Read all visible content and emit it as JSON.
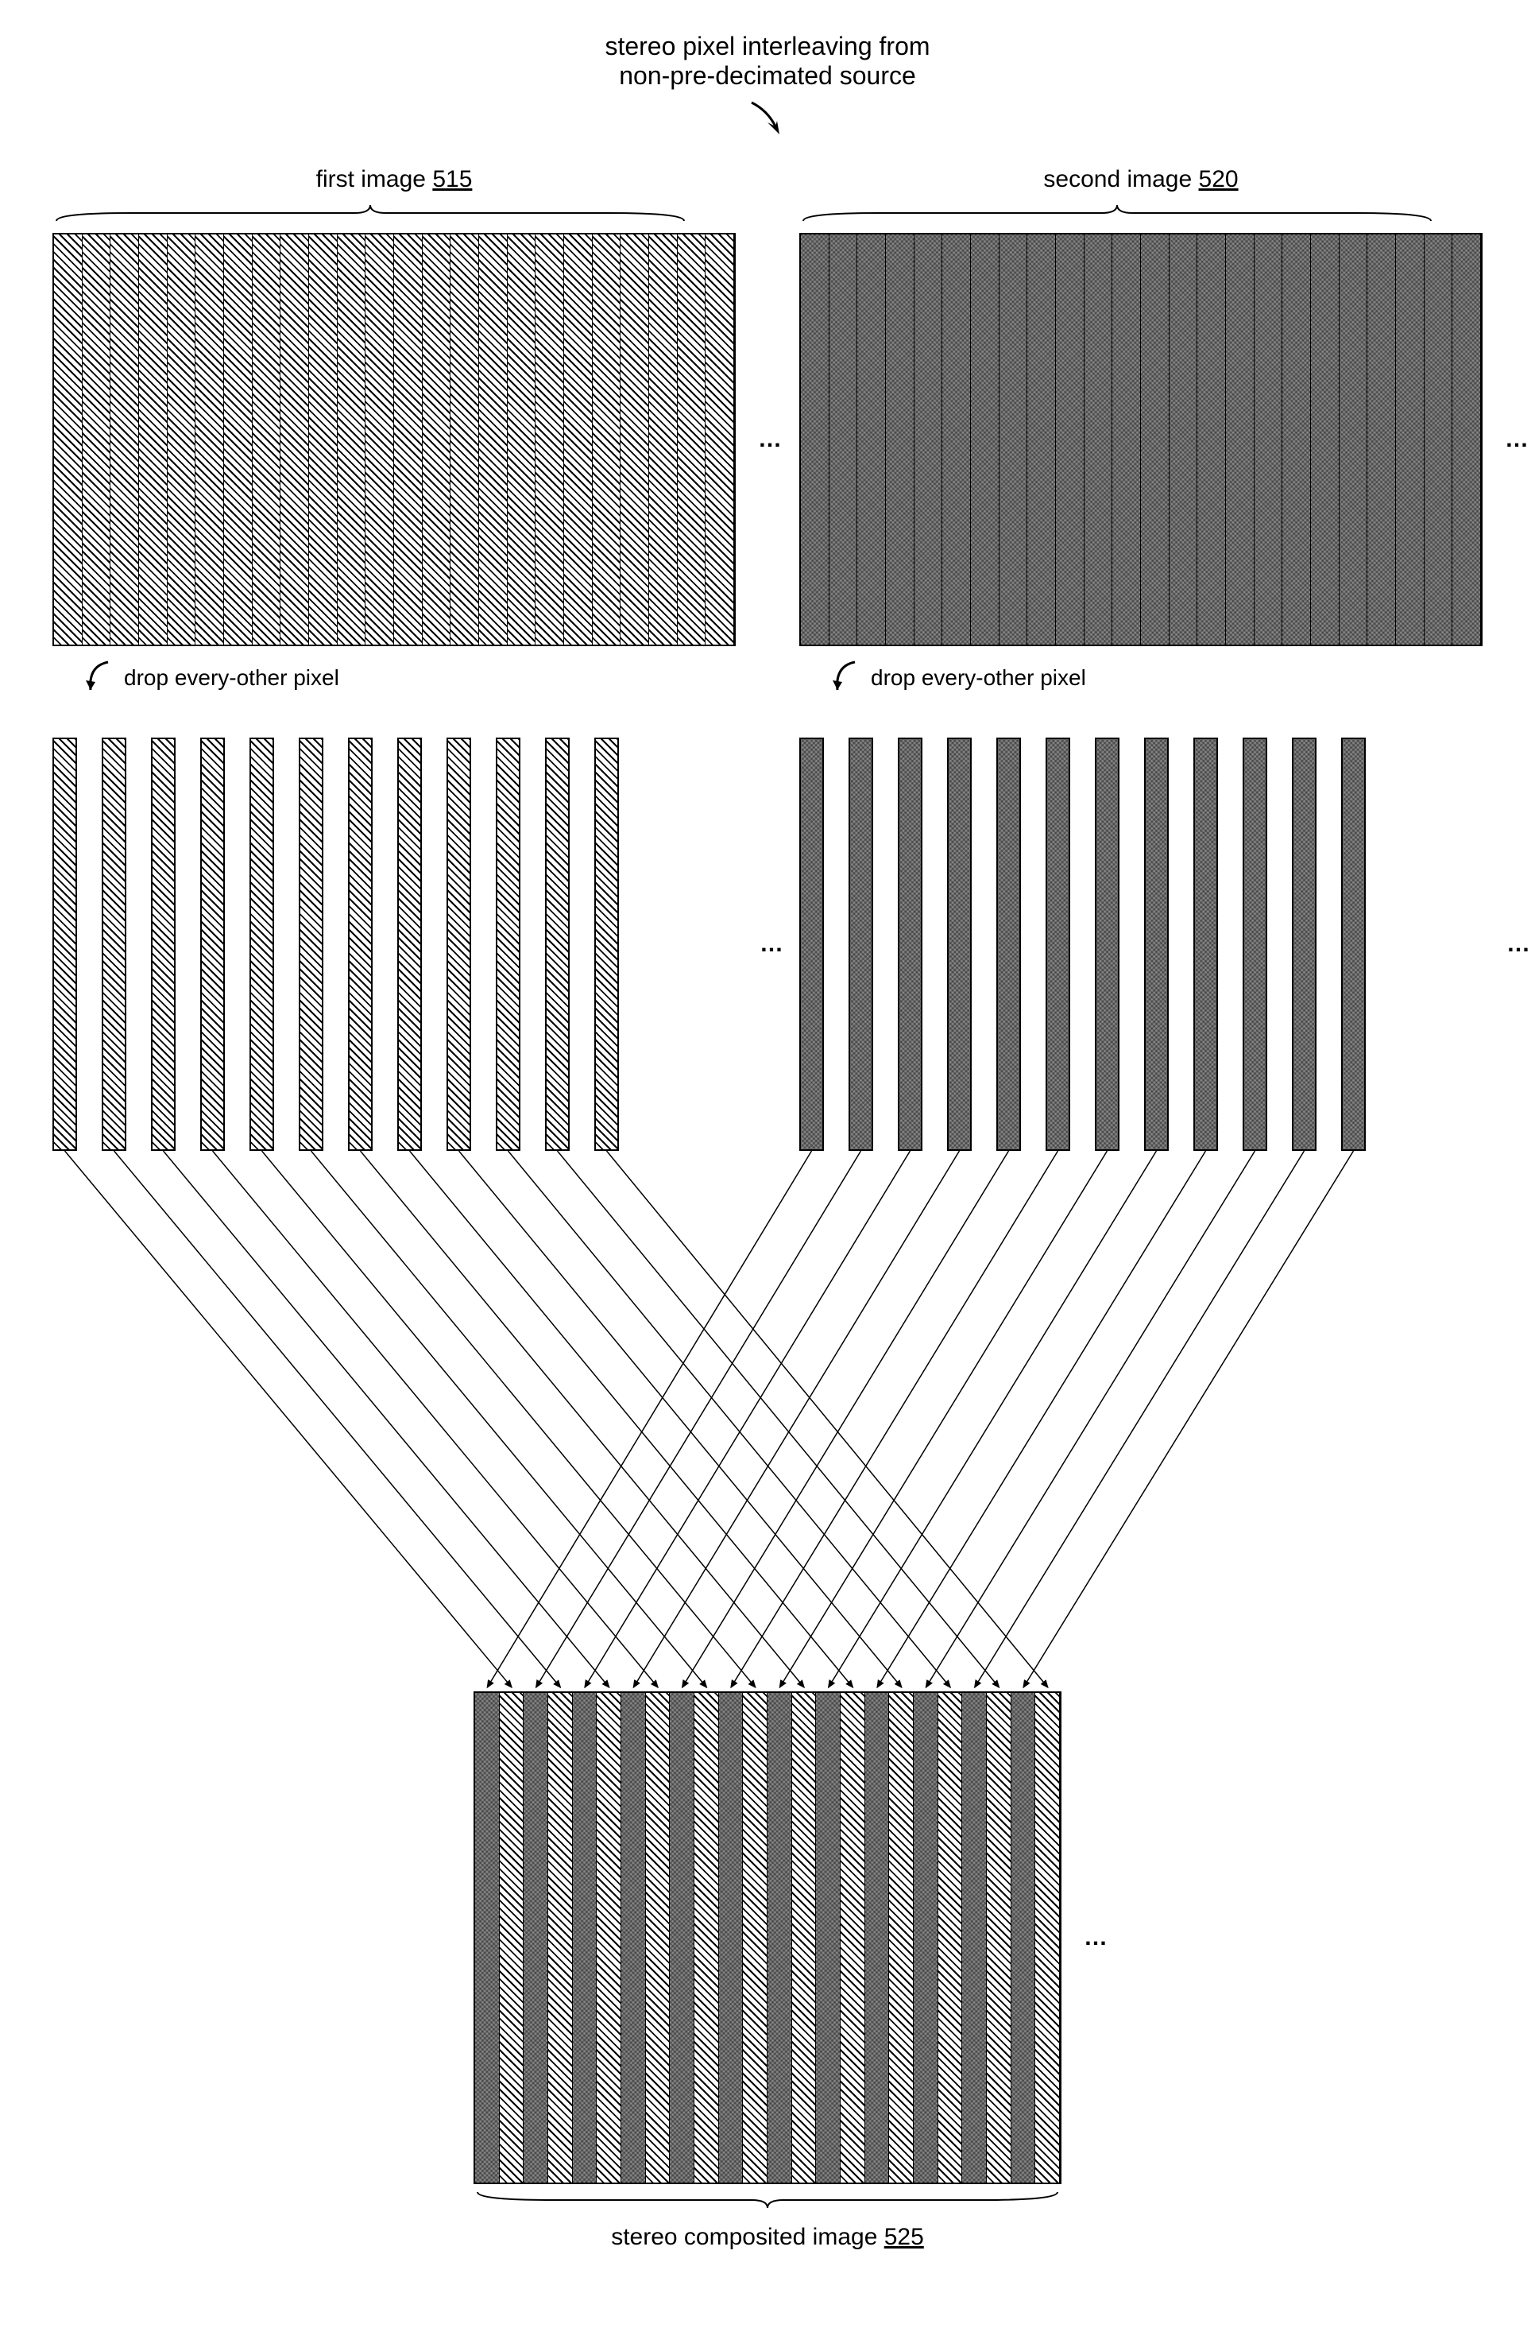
{
  "title_line1": "stereo pixel interleaving from",
  "title_line2": "non-pre-decimated source",
  "first_image_label": "first image",
  "first_image_ref": "515",
  "second_image_label": "second image",
  "second_image_ref": "520",
  "drop_label": "drop every-other pixel",
  "ellipsis": "…",
  "final_label": "stereo composited image",
  "final_ref": "525",
  "first_image_columns": 24,
  "second_image_columns": 24,
  "sparse_columns": 12,
  "final_columns": 24,
  "chart_data": {
    "type": "diagram",
    "description": "Stereo pixel interleaving process: two source images each drop every-other pixel column, then the remaining columns interleave into a single stereo composited image.",
    "sources": [
      {
        "name": "first image",
        "ref": 515,
        "pattern": "hatched",
        "columns": 24
      },
      {
        "name": "second image",
        "ref": 520,
        "pattern": "crosshatched",
        "columns": 24
      }
    ],
    "step": "drop every-other pixel",
    "sparse_columns_per_image": 12,
    "output": {
      "name": "stereo composited image",
      "ref": 525,
      "columns": 24,
      "pattern": "alternating"
    }
  }
}
